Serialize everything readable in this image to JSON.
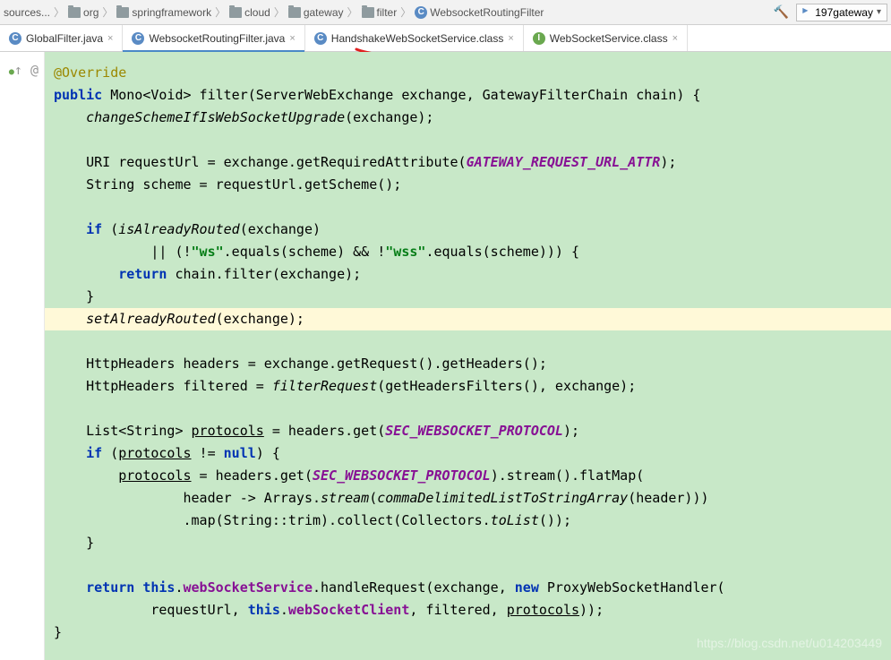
{
  "breadcrumb": {
    "root": "sources...",
    "items": [
      "org",
      "springframework",
      "cloud",
      "gateway",
      "filter"
    ],
    "leaf": "WebsocketRoutingFilter"
  },
  "runconfig": {
    "label": "197gateway"
  },
  "tabs": [
    {
      "label": "GlobalFilter.java",
      "icon": "class",
      "active": false
    },
    {
      "label": "WebsocketRoutingFilter.java",
      "icon": "class",
      "active": true
    },
    {
      "label": "HandshakeWebSocketService.class",
      "icon": "class",
      "active": false
    },
    {
      "label": "WebSocketService.class",
      "icon": "interface",
      "active": false
    }
  ],
  "gutter": [
    "↑",
    "@"
  ],
  "code": {
    "l1": "@Override",
    "l2a": "public",
    "l2b": " Mono<Void> filter(ServerWebExchange exchange, GatewayFilterChain chain) {",
    "l3a": "    ",
    "l3b": "changeSchemeIfIsWebSocketUpgrade",
    "l3c": "(exchange);",
    "l4": "",
    "l5a": "    URI requestUrl = exchange.getRequiredAttribute(",
    "l5b": "GATEWAY_REQUEST_URL_ATTR",
    "l5c": ");",
    "l6": "    String scheme = requestUrl.getScheme();",
    "l7": "",
    "l8a": "    ",
    "l8b": "if",
    "l8c": " (",
    "l8d": "isAlreadyRouted",
    "l8e": "(exchange)",
    "l9a": "            || (!",
    "l9b": "\"ws\"",
    "l9c": ".equals(scheme) && !",
    "l9d": "\"wss\"",
    "l9e": ".equals(scheme))) {",
    "l10a": "        ",
    "l10b": "return",
    "l10c": " chain.filter(exchange);",
    "l11": "    }",
    "l12a": "    ",
    "l12b": "setAlreadyRouted",
    "l12c": "(exchange);",
    "l13": "",
    "l14": "    HttpHeaders headers = exchange.getRequest().getHeaders();",
    "l15a": "    HttpHeaders filtered = ",
    "l15b": "filterRequest",
    "l15c": "(getHeadersFilters(), exchange);",
    "l16": "",
    "l17a": "    List<String> ",
    "l17b": "protocols",
    "l17c": " = headers.get(",
    "l17d": "SEC_WEBSOCKET_PROTOCOL",
    "l17e": ");",
    "l18a": "    ",
    "l18b": "if",
    "l18c": " (",
    "l18d": "protocols",
    "l18e": " != ",
    "l18f": "null",
    "l18g": ") {",
    "l19a": "        ",
    "l19b": "protocols",
    "l19c": " = headers.get(",
    "l19d": "SEC_WEBSOCKET_PROTOCOL",
    "l19e": ").stream().flatMap(",
    "l20a": "                header -> Arrays.",
    "l20b": "stream",
    "l20c": "(",
    "l20d": "commaDelimitedListToStringArray",
    "l20e": "(header)))",
    "l21a": "                .map(String::trim).collect(Collectors.",
    "l21b": "toList",
    "l21c": "());",
    "l22": "    }",
    "l23": "",
    "l24a": "    ",
    "l24b": "return",
    "l24c": " ",
    "l24d": "this",
    "l24e": ".",
    "l24f": "webSocketService",
    "l24g": ".handleRequest(exchange, ",
    "l24h": "new",
    "l24i": " ProxyWebSocketHandler(",
    "l25a": "            requestUrl, ",
    "l25b": "this",
    "l25c": ".",
    "l25d": "webSocketClient",
    "l25e": ", filtered, ",
    "l25f": "protocols",
    "l25g": "));",
    "l26": "}"
  },
  "watermark": "https://blog.csdn.net/u014203449"
}
